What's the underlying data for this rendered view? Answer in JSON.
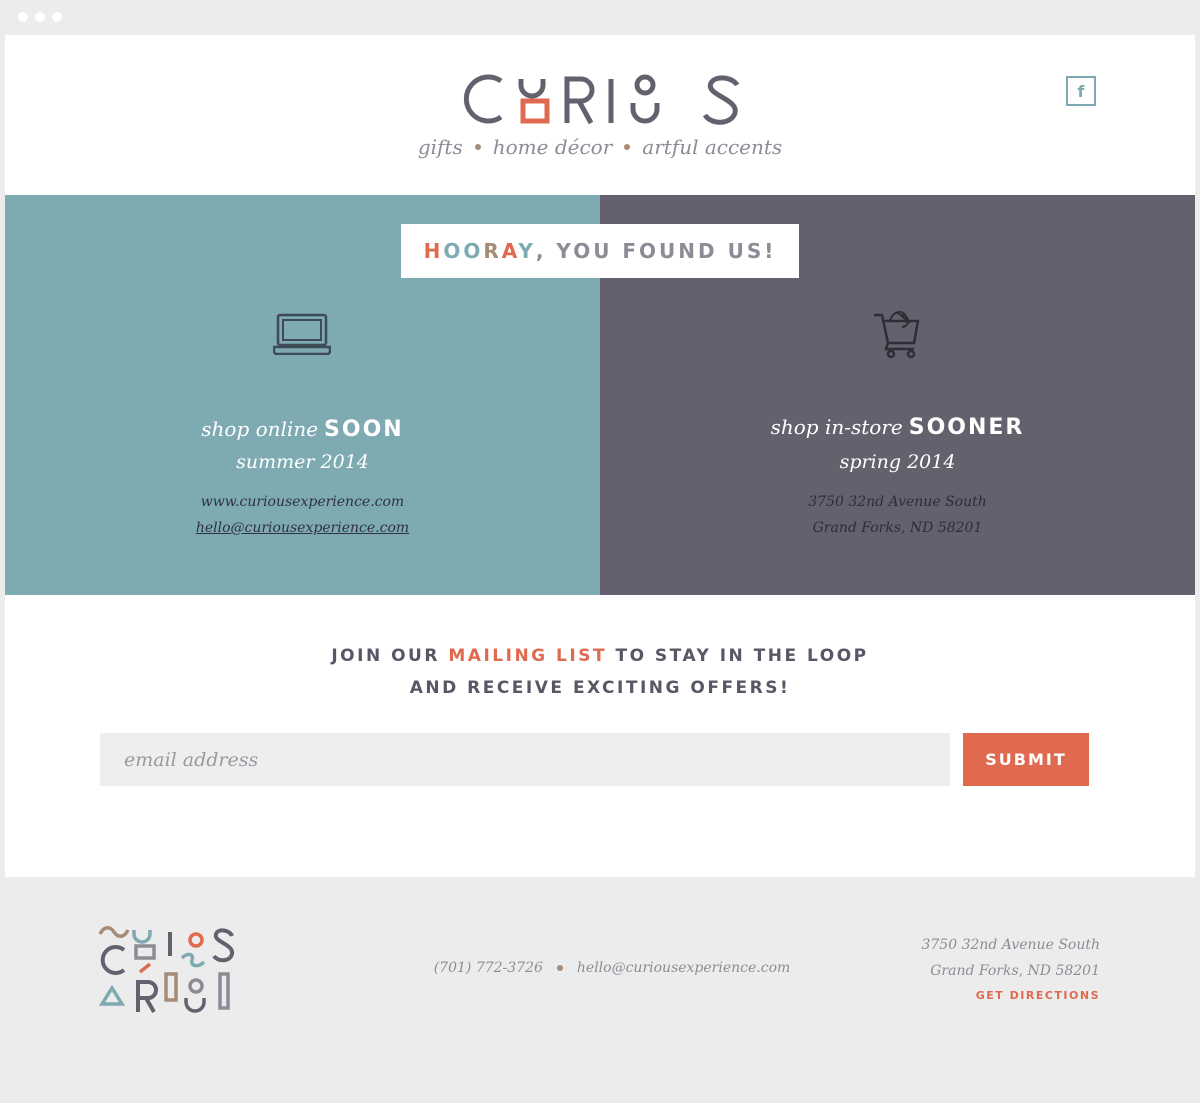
{
  "brand": {
    "logo_text": "CURIOS",
    "tagline_items": [
      "gifts",
      "home décor",
      "artful accents"
    ]
  },
  "header": {
    "facebook_icon": "facebook-icon"
  },
  "banner": {
    "hooray_letters": [
      {
        "ch": "H",
        "color": "#e06a50"
      },
      {
        "ch": "O",
        "color": "#7eaab1"
      },
      {
        "ch": "O",
        "color": "#7eaab1"
      },
      {
        "ch": "R",
        "color": "#a68c76"
      },
      {
        "ch": "A",
        "color": "#e06a50"
      },
      {
        "ch": "Y",
        "color": "#7eaab1"
      }
    ],
    "rest": ", YOU FOUND US!"
  },
  "online": {
    "icon": "laptop-icon",
    "label": "shop online",
    "strong": "SOON",
    "season": "summer 2014",
    "website": "www.curiousexperience.com",
    "email": "hello@curiousexperience.com"
  },
  "instore": {
    "icon": "shopping-cart-icon",
    "label": "shop in-store",
    "strong": "SOONER",
    "season": "spring 2014",
    "address_line1": "3750 32nd Avenue South",
    "address_line2": "Grand Forks, ND 58201"
  },
  "mailing": {
    "line1_pre": "JOIN OUR",
    "line1_accent": "MAILING LIST",
    "line1_post": "TO STAY IN THE LOOP",
    "line2": "AND RECEIVE EXCITING OFFERS!",
    "email_placeholder": "email address",
    "submit_label": "SUBMIT"
  },
  "footer": {
    "phone": "(701) 772-3726",
    "email": "hello@curiousexperience.com",
    "address_line1": "3750 32nd Avenue South",
    "address_line2": "Grand Forks, ND 58201",
    "directions_label": "GET DIRECTIONS"
  },
  "colors": {
    "teal": "#7eaab1",
    "slate": "#63616e",
    "coral": "#e06a50",
    "tan": "#a68c76",
    "gray_text": "#8d8c96"
  }
}
